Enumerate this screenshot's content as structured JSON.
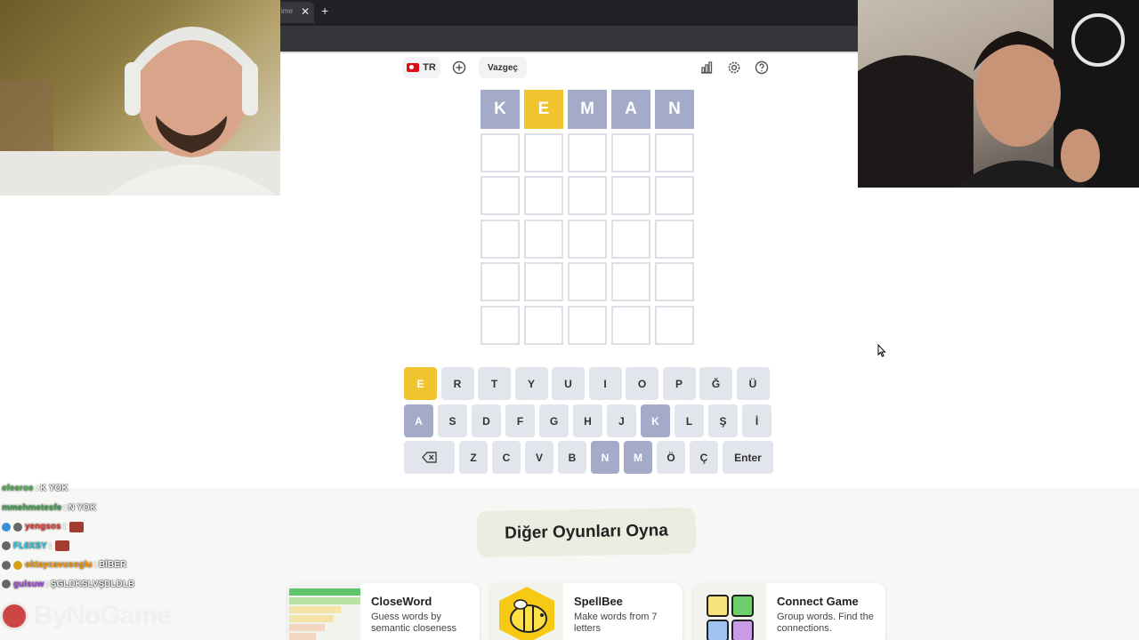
{
  "browser": {
    "tab_label": "ime",
    "close_glyph": "✕",
    "new_tab_glyph": "+"
  },
  "header": {
    "language_code": "TR",
    "give_up_label": "Vazgeç",
    "icons": [
      "flag-tr-icon",
      "add-circle-icon",
      "stats-bar-icon",
      "gear-icon",
      "help-circle-icon"
    ]
  },
  "grid": {
    "rows": [
      [
        {
          "letter": "K",
          "state": "absent"
        },
        {
          "letter": "E",
          "state": "present"
        },
        {
          "letter": "M",
          "state": "absent"
        },
        {
          "letter": "A",
          "state": "absent"
        },
        {
          "letter": "N",
          "state": "absent"
        }
      ],
      [
        {
          "letter": "",
          "state": "empty"
        },
        {
          "letter": "",
          "state": "empty"
        },
        {
          "letter": "",
          "state": "empty"
        },
        {
          "letter": "",
          "state": "empty"
        },
        {
          "letter": "",
          "state": "empty"
        }
      ],
      [
        {
          "letter": "",
          "state": "empty"
        },
        {
          "letter": "",
          "state": "empty"
        },
        {
          "letter": "",
          "state": "empty"
        },
        {
          "letter": "",
          "state": "empty"
        },
        {
          "letter": "",
          "state": "empty"
        }
      ],
      [
        {
          "letter": "",
          "state": "empty"
        },
        {
          "letter": "",
          "state": "empty"
        },
        {
          "letter": "",
          "state": "empty"
        },
        {
          "letter": "",
          "state": "empty"
        },
        {
          "letter": "",
          "state": "empty"
        }
      ],
      [
        {
          "letter": "",
          "state": "empty"
        },
        {
          "letter": "",
          "state": "empty"
        },
        {
          "letter": "",
          "state": "empty"
        },
        {
          "letter": "",
          "state": "empty"
        },
        {
          "letter": "",
          "state": "empty"
        }
      ],
      [
        {
          "letter": "",
          "state": "empty"
        },
        {
          "letter": "",
          "state": "empty"
        },
        {
          "letter": "",
          "state": "empty"
        },
        {
          "letter": "",
          "state": "empty"
        },
        {
          "letter": "",
          "state": "empty"
        }
      ]
    ]
  },
  "keyboard": {
    "rows": [
      [
        {
          "label": "E",
          "state": "present"
        },
        {
          "label": "R",
          "state": "unused"
        },
        {
          "label": "T",
          "state": "unused"
        },
        {
          "label": "Y",
          "state": "unused"
        },
        {
          "label": "U",
          "state": "unused"
        },
        {
          "label": "I",
          "state": "unused"
        },
        {
          "label": "O",
          "state": "unused"
        },
        {
          "label": "P",
          "state": "unused"
        },
        {
          "label": "Ğ",
          "state": "unused"
        },
        {
          "label": "Ü",
          "state": "unused"
        }
      ],
      [
        {
          "label": "A",
          "state": "absent"
        },
        {
          "label": "S",
          "state": "unused"
        },
        {
          "label": "D",
          "state": "unused"
        },
        {
          "label": "F",
          "state": "unused"
        },
        {
          "label": "G",
          "state": "unused"
        },
        {
          "label": "H",
          "state": "unused"
        },
        {
          "label": "J",
          "state": "unused"
        },
        {
          "label": "K",
          "state": "absent"
        },
        {
          "label": "L",
          "state": "unused"
        },
        {
          "label": "Ş",
          "state": "unused"
        },
        {
          "label": "İ",
          "state": "unused"
        }
      ],
      [
        {
          "label": "",
          "state": "unused",
          "icon": "backspace-icon"
        },
        {
          "label": "Z",
          "state": "unused"
        },
        {
          "label": "C",
          "state": "unused"
        },
        {
          "label": "V",
          "state": "unused"
        },
        {
          "label": "B",
          "state": "unused"
        },
        {
          "label": "N",
          "state": "absent"
        },
        {
          "label": "M",
          "state": "absent"
        },
        {
          "label": "Ö",
          "state": "unused"
        },
        {
          "label": "Ç",
          "state": "unused"
        },
        {
          "label": "Enter",
          "state": "unused"
        }
      ]
    ]
  },
  "colors": {
    "absent": "#a3abc8",
    "present": "#f0c42f",
    "unused": "#e2e5ec",
    "empty_border": "#dcdfe5"
  },
  "chat": {
    "messages": [
      {
        "user": "efeeroe",
        "user_color": "#4caf50",
        "text": "K YOK",
        "badges": [],
        "emote": false
      },
      {
        "user": "mmehmetesfe",
        "user_color": "#3fa34d",
        "text": "N YOK",
        "badges": [],
        "emote": false
      },
      {
        "user": "yengsos",
        "user_color": "#e53935",
        "text": "",
        "badges": [
          "#3b8fd9",
          "#666666"
        ],
        "emote": true
      },
      {
        "user": "FL0XSY",
        "user_color": "#26c6da",
        "text": "",
        "badges": [
          "#666666"
        ],
        "emote": true
      },
      {
        "user": "oktaycavusoglu",
        "user_color": "#ff9800",
        "text": "BİBER",
        "badges": [
          "#666666",
          "#d4a017"
        ],
        "emote": false
      },
      {
        "user": "gulsuw",
        "user_color": "#9c4dcc",
        "text": "ŞGLDKSLVŞDLDLB",
        "badges": [
          "#666666"
        ],
        "emote": false
      }
    ]
  },
  "watermark": {
    "text": "ByNoGame"
  },
  "other_games": {
    "title": "Diğer Oyunları Oyna",
    "cards": [
      {
        "title": "CloseWord",
        "description": "Guess words by semantic closeness",
        "icon": "closeword-thumbnail"
      },
      {
        "title": "SpellBee",
        "description": "Make words from 7 letters",
        "icon": "bee-icon"
      },
      {
        "title": "Connect Game",
        "description": "Group words. Find the connections.",
        "icon": "color-grid-icon"
      }
    ]
  }
}
